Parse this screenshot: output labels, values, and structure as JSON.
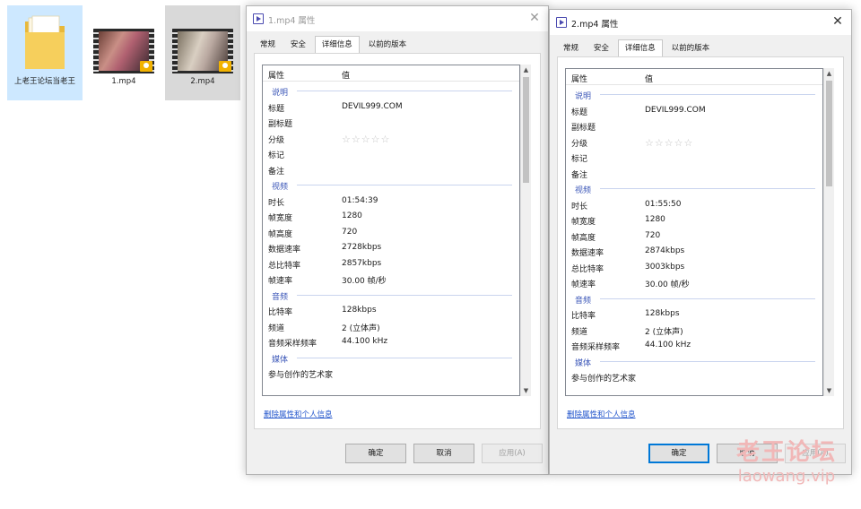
{
  "desktop": {
    "files": [
      {
        "label": "上老王论坛当老王"
      },
      {
        "label": "1.mp4"
      },
      {
        "label": "2.mp4"
      }
    ]
  },
  "dialogs": [
    {
      "title": "1.mp4 属性",
      "tabs": [
        "常规",
        "安全",
        "详细信息",
        "以前的版本"
      ],
      "active_tab": "详细信息",
      "columns": {
        "property": "属性",
        "value": "值"
      },
      "rows": [
        {
          "type": "group",
          "key": "说明"
        },
        {
          "key": "标题",
          "value": "DEVIL999.COM"
        },
        {
          "key": "副标题",
          "value": ""
        },
        {
          "key": "分级",
          "value": "☆☆☆☆☆",
          "stars": true
        },
        {
          "key": "标记",
          "value": ""
        },
        {
          "key": "备注",
          "value": ""
        },
        {
          "type": "group",
          "key": "视频"
        },
        {
          "key": "时长",
          "value": "01:54:39"
        },
        {
          "key": "帧宽度",
          "value": "1280"
        },
        {
          "key": "帧高度",
          "value": "720"
        },
        {
          "key": "数据速率",
          "value": "2728kbps"
        },
        {
          "key": "总比特率",
          "value": "2857kbps"
        },
        {
          "key": "帧速率",
          "value": "30.00 帧/秒"
        },
        {
          "type": "group",
          "key": "音频"
        },
        {
          "key": "比特率",
          "value": "128kbps"
        },
        {
          "key": "频道",
          "value": "2 (立体声)"
        },
        {
          "key": "音频采样频率",
          "value": "44.100 kHz"
        },
        {
          "type": "group",
          "key": "媒体"
        },
        {
          "key": "参与创作的艺术家",
          "value": ""
        }
      ],
      "link": "删除属性和个人信息",
      "buttons": {
        "ok": "确定",
        "cancel": "取消",
        "apply": "应用(A)"
      }
    },
    {
      "title": "2.mp4 属性",
      "tabs": [
        "常规",
        "安全",
        "详细信息",
        "以前的版本"
      ],
      "active_tab": "详细信息",
      "columns": {
        "property": "属性",
        "value": "值"
      },
      "rows": [
        {
          "type": "group",
          "key": "说明"
        },
        {
          "key": "标题",
          "value": "DEVIL999.COM"
        },
        {
          "key": "副标题",
          "value": ""
        },
        {
          "key": "分级",
          "value": "☆☆☆☆☆",
          "stars": true
        },
        {
          "key": "标记",
          "value": ""
        },
        {
          "key": "备注",
          "value": ""
        },
        {
          "type": "group",
          "key": "视频"
        },
        {
          "key": "时长",
          "value": "01:55:50"
        },
        {
          "key": "帧宽度",
          "value": "1280"
        },
        {
          "key": "帧高度",
          "value": "720"
        },
        {
          "key": "数据速率",
          "value": "2874kbps"
        },
        {
          "key": "总比特率",
          "value": "3003kbps"
        },
        {
          "key": "帧速率",
          "value": "30.00 帧/秒"
        },
        {
          "type": "group",
          "key": "音频"
        },
        {
          "key": "比特率",
          "value": "128kbps"
        },
        {
          "key": "频道",
          "value": "2 (立体声)"
        },
        {
          "key": "音频采样频率",
          "value": "44.100 kHz"
        },
        {
          "type": "group",
          "key": "媒体"
        },
        {
          "key": "参与创作的艺术家",
          "value": ""
        }
      ],
      "link": "删除属性和个人信息",
      "buttons": {
        "ok": "确定",
        "cancel": "取消",
        "apply": "应用(A)"
      }
    }
  ],
  "watermark": {
    "line1": "老王论坛",
    "line2": "laowang.vip",
    "color": "#f1b7b7"
  },
  "icons": {
    "folder": "folder-icon",
    "video": "video-file-icon",
    "dialog": "video-properties-icon",
    "close": "close-icon"
  }
}
